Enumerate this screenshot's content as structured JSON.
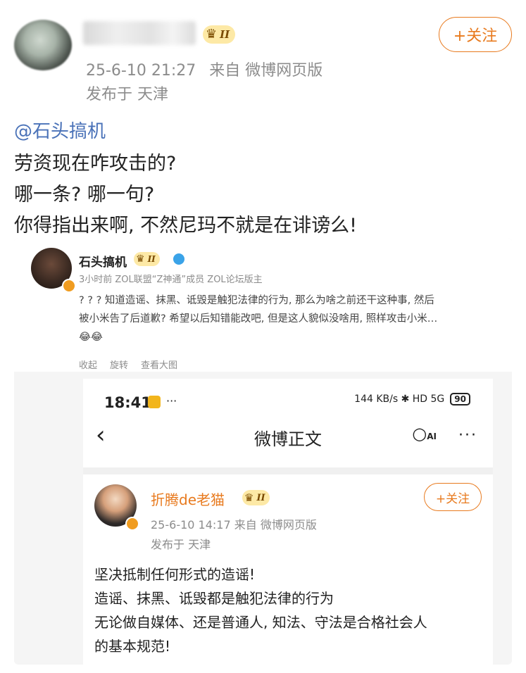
{
  "header": {
    "vip_level": "II",
    "timestamp": "25-6-10 21:27",
    "source": "来自 微博网页版",
    "location": "发布于 天津",
    "follow_label": "+关注"
  },
  "post": {
    "mention": "@石头搞机",
    "lines": [
      "劳资现在咋攻击的?",
      "哪一条? 哪一句?",
      "你得指出来啊, 不然尼玛不就是在诽谤么!"
    ]
  },
  "embedded_post": {
    "author": "石头搞机",
    "vip_level": "II",
    "meta": "3小时前 ZOL联盟“Z神通”成员 ZOL论坛版主",
    "text_lines": [
      "? ? ? 知道造谣、抹黑、诋毁是触犯法律的行为, 那么为啥之前还干这种事, 然后",
      "被小米告了后道歉? 希望以后知错能改吧, 但是这人貌似没啥用, 照样攻击小米…",
      "😂😂"
    ],
    "actions": [
      "收起",
      "旋转",
      "查看大图"
    ]
  },
  "phone": {
    "time": "18:41",
    "status_icons": "144 KB/s  ✱  HD  5G",
    "battery": "90",
    "nav_title": "微博正文",
    "ai_label": "AI",
    "more": "···",
    "repost": {
      "author": "折腾de老猫",
      "vip_level": "II",
      "timestamp": "25-6-10 14:17  来自 微博网页版",
      "location": "发布于 天津",
      "follow_label": "+关注",
      "text_lines": [
        "坚决抵制任何形式的造谣!",
        "造谣、抹黑、诋毁都是触犯法律的行为",
        "无论做自媒体、还是普通人, 知法、守法是合格社会人",
        "的基本规范!"
      ]
    }
  },
  "colors": {
    "accent": "#e87a1e",
    "link": "#4a72b8",
    "muted": "#8c8c8c",
    "vip_bg": "#fde9a6"
  },
  "icons": [
    "crown-icon",
    "back-arrow-icon",
    "more-icon",
    "bluetooth-icon",
    "battery-icon",
    "verified-icon"
  ]
}
